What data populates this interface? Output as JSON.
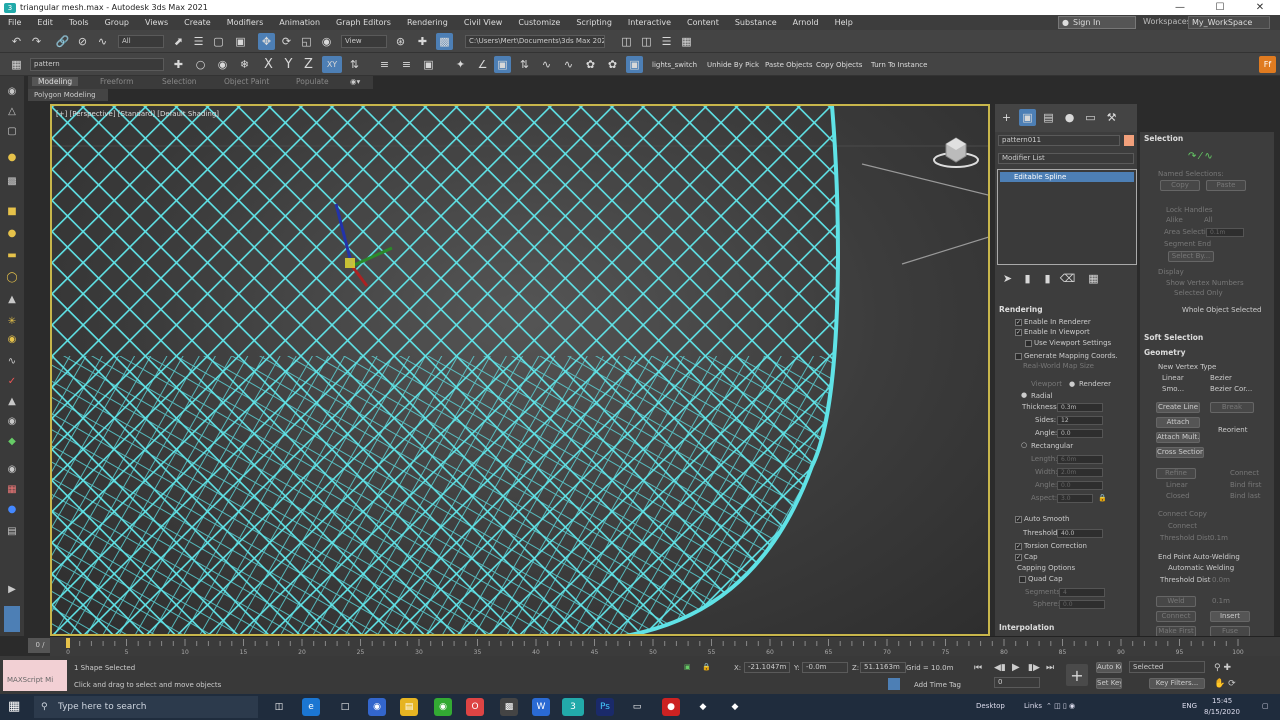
{
  "titlebar": {
    "title": "triangular mesh.max - Autodesk 3ds Max 2021",
    "minimize_icon": "minimize-icon",
    "maximize_icon": "maximize-icon",
    "close_icon": "close-icon"
  },
  "menu": {
    "items": [
      "File",
      "Edit",
      "Tools",
      "Group",
      "Views",
      "Create",
      "Modifiers",
      "Animation",
      "Graph Editors",
      "Rendering",
      "Civil View",
      "Customize",
      "Scripting",
      "Interactive",
      "Content",
      "Substance",
      "Arnold",
      "Help"
    ],
    "signin": "Sign In",
    "workspaces_label": "Workspaces:",
    "workspace_value": "My_WorkSpace"
  },
  "toolbar1": {
    "selection_filter": "All",
    "ref_coord": "View",
    "project_path": "C:\\Users\\Mert\\Documents\\3ds Max 2021"
  },
  "toolbar2": {
    "named_selection": "pattern",
    "axes": [
      "X",
      "Y",
      "Z",
      "XY"
    ],
    "lights_switch": "lights_switch",
    "unhide_by_pick": "Unhide By Pick",
    "paste_objects": "Paste Objects",
    "copy_objects": "Copy Objects",
    "turn_to_instance": "Turn To Instance"
  },
  "ribbon": {
    "tabs": [
      "Modeling",
      "Freeform",
      "Selection",
      "Object Paint",
      "Populate"
    ],
    "sub": "Polygon Modeling"
  },
  "viewport": {
    "label": "[+] [Perspective] [Standard] [Default Shading]",
    "mesh_color": "#5fe2e6"
  },
  "modify_panel": {
    "object_name": "pattern011",
    "modifier_list": "Modifier List",
    "stack_item": "Editable Spline",
    "rendering": {
      "title": "Rendering",
      "enable_renderer": "Enable In Renderer",
      "enable_viewport": "Enable In Viewport",
      "use_viewport_settings": "Use Viewport Settings",
      "generate_mapping": "Generate Mapping Coords.",
      "real_world": "Real-World Map Size",
      "viewport": "Viewport",
      "renderer": "Renderer",
      "radial": "Radial",
      "thickness_label": "Thickness:",
      "thickness": "0.3m",
      "sides_label": "Sides:",
      "sides": "12",
      "angle_label": "Angle:",
      "angle": "0.0",
      "rectangular": "Rectangular",
      "length_label": "Length:",
      "length": "6.0m",
      "width_label": "Width:",
      "width": "2.0m",
      "angle2_label": "Angle:",
      "angle2": "0.0",
      "aspect_label": "Aspect:",
      "aspect": "3.0",
      "auto_smooth": "Auto Smooth",
      "threshold_label": "Threshold:",
      "threshold": "40.0",
      "torsion": "Torsion Correction",
      "cap": "Cap",
      "capping_options": "Capping Options",
      "quad_cap": "Quad Cap",
      "segments_label": "Segments:",
      "segments": "4",
      "sphere_label": "Sphere:",
      "sphere": "0.0"
    },
    "interpolation": "Interpolation"
  },
  "selection_panel": {
    "title": "Selection",
    "named_selections": "Named Selections:",
    "copy": "Copy",
    "paste": "Paste",
    "lock_handles": "Lock Handles",
    "alike": "Alike",
    "all": "All",
    "area_selection": "Area Selection:",
    "area_value": "0.1m",
    "segment_end": "Segment End",
    "select_by": "Select By...",
    "display": "Display",
    "show_vertex_numbers": "Show Vertex Numbers",
    "selected_only": "Selected Only",
    "whole_object": "Whole Object Selected",
    "soft_selection": "Soft Selection",
    "geometry": "Geometry",
    "new_vertex_type": "New Vertex Type",
    "linear": "Linear",
    "bezier": "Bezier",
    "smooth": "Smo...",
    "bezier_corner": "Bezier Cor...",
    "create_line": "Create Line",
    "break": "Break",
    "attach": "Attach",
    "reorient": "Reorient",
    "attach_mult": "Attach Mult.",
    "cross_section": "Cross Section",
    "refine": "Refine",
    "connect": "Connect",
    "linear2": "Linear",
    "bind_first": "Bind first",
    "closed": "Closed",
    "bind_last": "Bind last",
    "connect_copy": "Connect Copy",
    "connect_btn": "Connect",
    "threshold_label": "Threshold Dist",
    "threshold_val": "0.1m",
    "end_point": "End Point Auto-Welding",
    "auto_welding": "Automatic Welding",
    "threshold_dist": "Threshold Dist",
    "threshold_dist_val": "0.0m",
    "weld": "Weld",
    "weld_val": "0.1m",
    "connect2": "Connect",
    "insert": "Insert",
    "make_first": "Make First",
    "fuse": "Fuse"
  },
  "timeline": {
    "frame": "0 / 100",
    "ticks": [
      "0",
      "5",
      "10",
      "15",
      "20",
      "25",
      "30",
      "35",
      "40",
      "45",
      "50",
      "55",
      "60",
      "65",
      "70",
      "75",
      "80",
      "85",
      "90",
      "95",
      "100"
    ]
  },
  "status": {
    "maxscript": "MAXScript Mi",
    "shape_selected": "1 Shape Selected",
    "hint": "Click and drag to select and move objects",
    "x_label": "X:",
    "x": "-21.1047m",
    "y_label": "Y:",
    "y": "-0.0m",
    "z_label": "Z:",
    "z": "51.1163m",
    "grid": "Grid = 10.0m",
    "add_time_tag": "Add Time Tag",
    "auto_key": "Auto Key",
    "set_key": "Set Key",
    "selected": "Selected",
    "key_filters": "Key Filters...",
    "frame_value": "0"
  },
  "taskbar": {
    "search": "Type here to search",
    "desktop": "Desktop",
    "links": "Links",
    "lang": "ENG",
    "time": "15:45",
    "date": "8/15/2020"
  }
}
